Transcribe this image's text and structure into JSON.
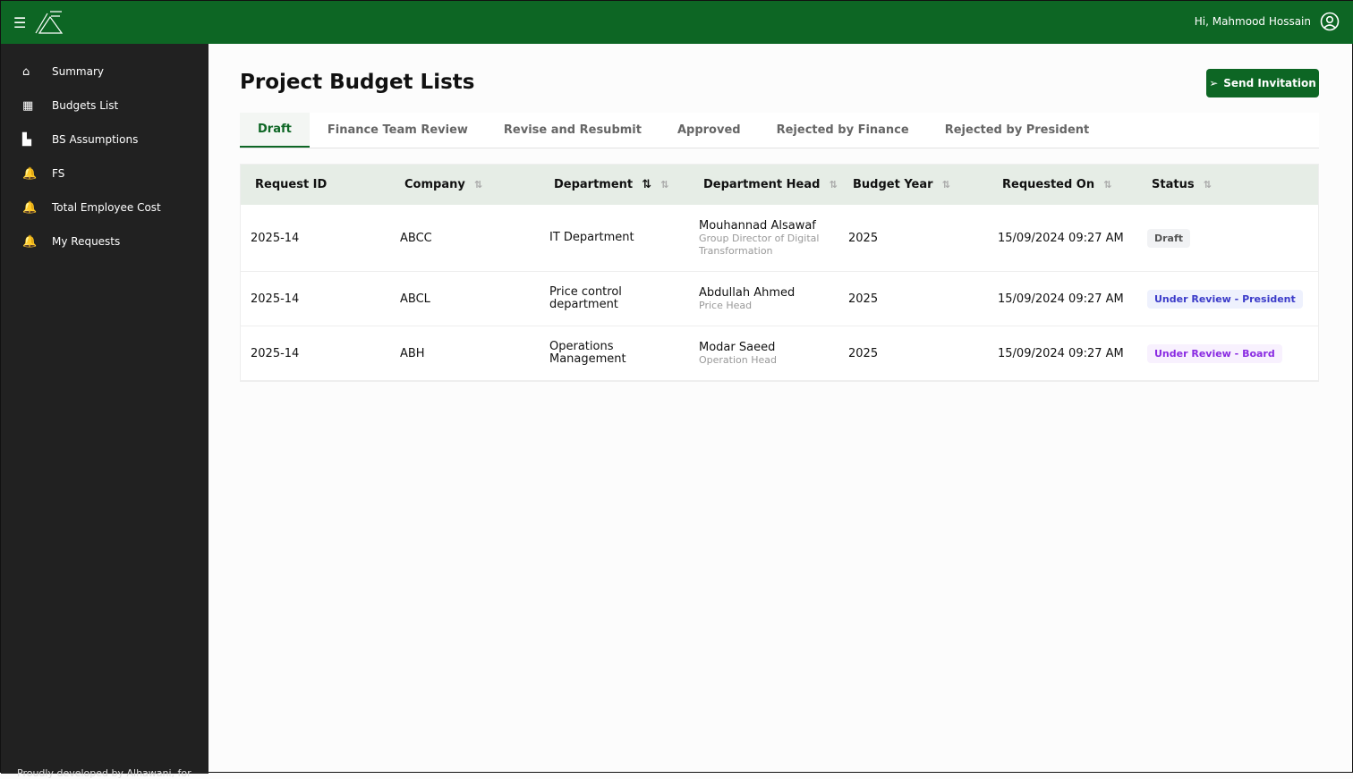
{
  "header": {
    "greeting": "Hi, Mahmood Hossain",
    "brand_color": "#0d6624"
  },
  "sidebar": {
    "items": [
      {
        "label": "Summary",
        "icon": "home-icon",
        "glyph": "⌂"
      },
      {
        "label": "Budgets List",
        "icon": "budget-calculator-icon",
        "glyph": "▦"
      },
      {
        "label": "BS Assumptions",
        "icon": "chart-icon",
        "glyph": "▙"
      },
      {
        "label": "FS",
        "icon": "bell-icon",
        "glyph": "🔔"
      },
      {
        "label": "Total Employee Cost",
        "icon": "bell-icon",
        "glyph": "🔔"
      },
      {
        "label": "My Requests",
        "icon": "bell-icon",
        "glyph": "🔔"
      }
    ],
    "footer": "Proudly developed by Alhawani, for"
  },
  "page": {
    "title": "Project Budget Lists",
    "send_label": "Send Invitation"
  },
  "tabs": [
    "Draft",
    "Finance Team Review",
    "Revise and Resubmit",
    "Approved",
    "Rejected by Finance",
    "Rejected by President"
  ],
  "table": {
    "columns": [
      "Request ID",
      "Company",
      "Department",
      "Department Head",
      "Budget Year",
      "Requested On",
      "Status"
    ],
    "rows": [
      {
        "id": "2025-14",
        "company": "ABCC",
        "department": "IT Department",
        "head": "Mouhannad Alsawaf",
        "head_title": "Group Director of Digital Transformation",
        "year": "2025",
        "requested": "15/09/2024 09:27 AM",
        "status": "Draft",
        "status_bg": "#f1f2f4",
        "status_fg": "#555"
      },
      {
        "id": "2025-14",
        "company": "ABCL",
        "department": "Price control department",
        "head": "Abdullah Ahmed",
        "head_title": "Price Head",
        "year": "2025",
        "requested": "15/09/2024 09:27 AM",
        "status": "Under Review - President",
        "status_bg": "#eef1fd",
        "status_fg": "#3b3bc9"
      },
      {
        "id": "2025-14",
        "company": "ABH",
        "department": "Operations Management",
        "head": "Modar Saeed",
        "head_title": "Operation Head",
        "year": "2025",
        "requested": "15/09/2024 09:27 AM",
        "status": "Under Review - Board",
        "status_bg": "#f8f1fe",
        "status_fg": "#8a2be2"
      }
    ]
  }
}
